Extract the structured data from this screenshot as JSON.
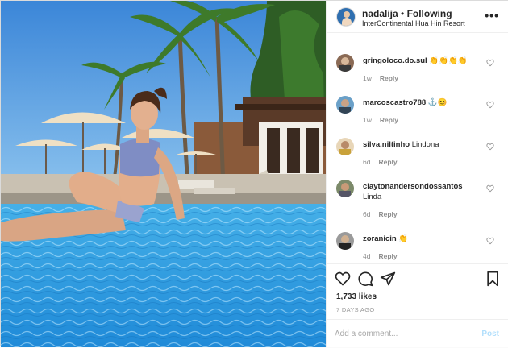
{
  "header": {
    "username": "nadalija",
    "separator": " • ",
    "follow_status": "Following",
    "location": "InterContinental Hua Hin Resort",
    "more_label": "•••"
  },
  "photo": {
    "icon": "post-photo"
  },
  "comments": [
    {
      "username": "gringoloco.do.sul",
      "text": "👏👏👏👏",
      "time": "1w",
      "reply_label": "Reply"
    },
    {
      "username": "marcoscastro788",
      "text": "⚓😊",
      "time": "1w",
      "reply_label": "Reply"
    },
    {
      "username": "silva.niltinho",
      "text": "Lindona",
      "time": "6d",
      "reply_label": "Reply"
    },
    {
      "username": "claytonandersondossantos",
      "text": "Linda",
      "time": "6d",
      "reply_label": "Reply"
    },
    {
      "username": "zoranicin",
      "text": "👏",
      "time": "4d",
      "reply_label": "Reply"
    }
  ],
  "actions": {
    "like_icon": "heart-icon",
    "comment_icon": "comment-icon",
    "share_icon": "share-icon",
    "save_icon": "bookmark-icon",
    "likes": "1,733 likes",
    "date": "7 DAYS AGO"
  },
  "add_comment": {
    "placeholder": "Add a comment...",
    "post_label": "Post"
  }
}
